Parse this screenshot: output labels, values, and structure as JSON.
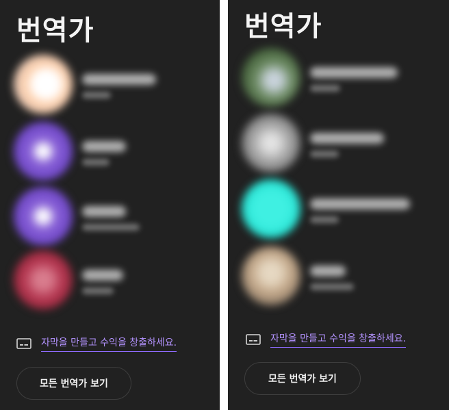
{
  "panels": [
    {
      "title": "번역가",
      "subtitle_link": "자막을 만들고 수익을 창출하세요.",
      "view_all_button": "모든 번역가 보기"
    },
    {
      "title": "번역가",
      "subtitle_link": "자막을 만들고 수익을 창출하세요.",
      "view_all_button": "모든 번역가 보기"
    }
  ],
  "colors": {
    "background": "#212121",
    "link": "#b493ff",
    "text": "#f1f1f1"
  },
  "icons": {
    "subtitle": "closed-caption-icon"
  }
}
